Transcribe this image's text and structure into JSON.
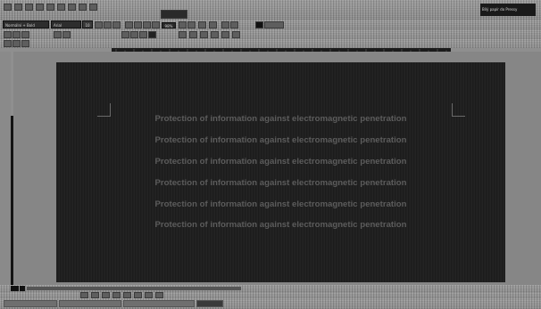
{
  "window": {
    "title": "Bílý papír do Pressy"
  },
  "toolbar": {
    "paragraph_style": "Normální + Bold",
    "font_name": "Arial",
    "font_size": "10",
    "zoom": "98%"
  },
  "document": {
    "lines": [
      "Protection of information against electromagnetic penetration",
      "Protection of information against electromagnetic penetration",
      "Protection of information against electromagnetic penetration",
      "Protection of information against electromagnetic penetration",
      "Protection of information against electromagnetic penetration",
      "Protection of information against electromagnetic penetration"
    ],
    "page_color": "#202020",
    "text_color": "#5c5c5c"
  }
}
